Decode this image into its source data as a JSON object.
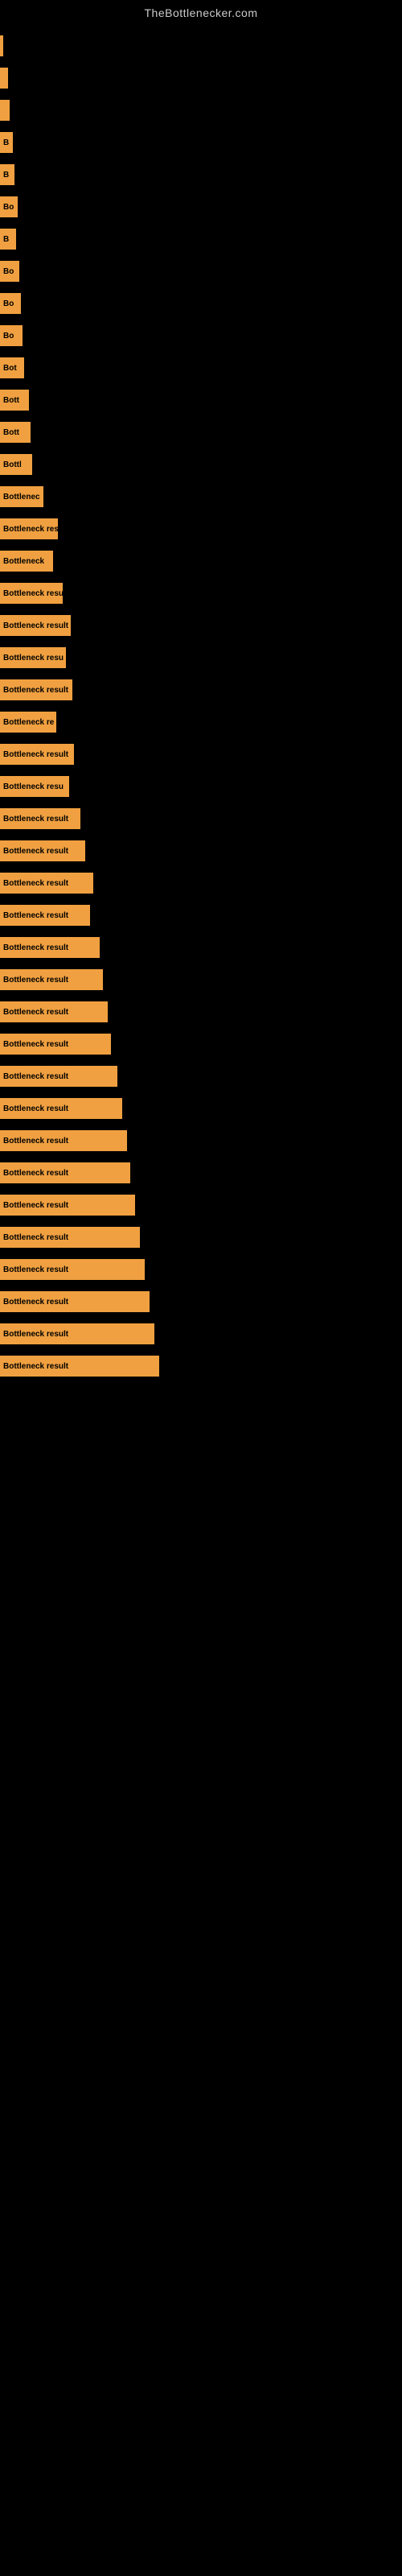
{
  "site": {
    "title": "TheBottlenecker.com"
  },
  "bars": [
    {
      "width": 4,
      "label": ""
    },
    {
      "width": 10,
      "label": ""
    },
    {
      "width": 12,
      "label": ""
    },
    {
      "width": 16,
      "label": "B"
    },
    {
      "width": 18,
      "label": "B"
    },
    {
      "width": 22,
      "label": "Bo"
    },
    {
      "width": 20,
      "label": "B"
    },
    {
      "width": 24,
      "label": "Bo"
    },
    {
      "width": 26,
      "label": "Bo"
    },
    {
      "width": 28,
      "label": "Bo"
    },
    {
      "width": 30,
      "label": "Bot"
    },
    {
      "width": 36,
      "label": "Bott"
    },
    {
      "width": 38,
      "label": "Bott"
    },
    {
      "width": 40,
      "label": "Bottl"
    },
    {
      "width": 54,
      "label": "Bottlenec"
    },
    {
      "width": 72,
      "label": "Bottleneck res"
    },
    {
      "width": 66,
      "label": "Bottleneck"
    },
    {
      "width": 78,
      "label": "Bottleneck resu"
    },
    {
      "width": 88,
      "label": "Bottleneck result"
    },
    {
      "width": 82,
      "label": "Bottleneck resu"
    },
    {
      "width": 90,
      "label": "Bottleneck result"
    },
    {
      "width": 70,
      "label": "Bottleneck re"
    },
    {
      "width": 92,
      "label": "Bottleneck result"
    },
    {
      "width": 86,
      "label": "Bottleneck resu"
    },
    {
      "width": 100,
      "label": "Bottleneck result"
    },
    {
      "width": 106,
      "label": "Bottleneck result"
    },
    {
      "width": 116,
      "label": "Bottleneck result"
    },
    {
      "width": 112,
      "label": "Bottleneck result"
    },
    {
      "width": 124,
      "label": "Bottleneck result"
    },
    {
      "width": 128,
      "label": "Bottleneck result"
    },
    {
      "width": 134,
      "label": "Bottleneck result"
    },
    {
      "width": 138,
      "label": "Bottleneck result"
    },
    {
      "width": 146,
      "label": "Bottleneck result"
    },
    {
      "width": 152,
      "label": "Bottleneck result"
    },
    {
      "width": 158,
      "label": "Bottleneck result"
    },
    {
      "width": 162,
      "label": "Bottleneck result"
    },
    {
      "width": 168,
      "label": "Bottleneck result"
    },
    {
      "width": 174,
      "label": "Bottleneck result"
    },
    {
      "width": 180,
      "label": "Bottleneck result"
    },
    {
      "width": 186,
      "label": "Bottleneck result"
    },
    {
      "width": 192,
      "label": "Bottleneck result"
    },
    {
      "width": 198,
      "label": "Bottleneck result"
    }
  ]
}
